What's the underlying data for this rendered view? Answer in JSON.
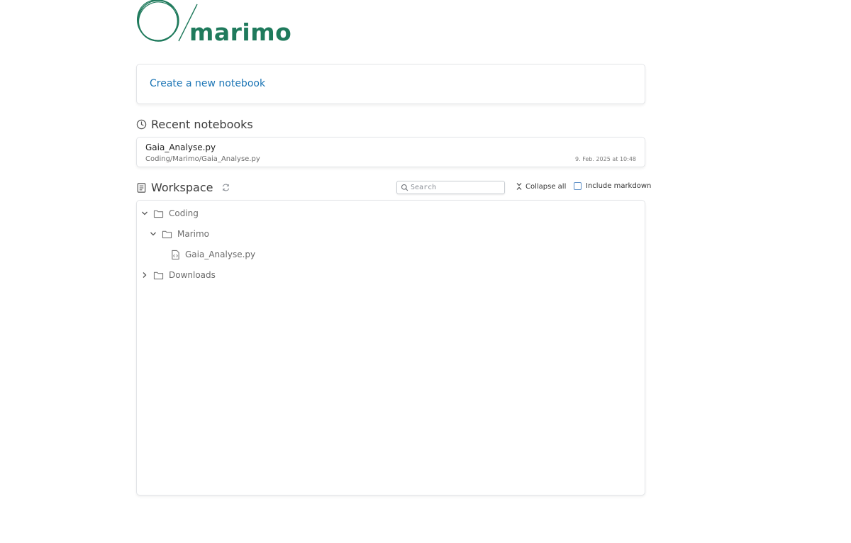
{
  "brand": {
    "name": "marimo",
    "color": "#1f7a5c"
  },
  "create": {
    "label": "Create a new notebook"
  },
  "recent": {
    "title": "Recent notebooks",
    "icon": "clock-icon",
    "items": [
      {
        "name": "Gaia_Analyse.py",
        "path": "Coding/Marimo/Gaia_Analyse.py",
        "date": "9. Feb. 2025 at 10:48"
      }
    ]
  },
  "workspace": {
    "title": "Workspace",
    "icon": "book-icon",
    "search_placeholder": "Search",
    "collapse_label": "Collapse all",
    "markdown_label": "Include markdown",
    "markdown_checked": false,
    "tree": [
      {
        "label": "Coding",
        "type": "folder",
        "expanded": true
      },
      {
        "label": "Marimo",
        "type": "folder",
        "expanded": true
      },
      {
        "label": "Gaia_Analyse.py",
        "type": "notebook"
      },
      {
        "label": "Downloads",
        "type": "folder",
        "expanded": false
      }
    ]
  },
  "colors": {
    "link": "#1a74b5",
    "border": "#e3e5e8",
    "checkbox": "#5d8fc7"
  }
}
